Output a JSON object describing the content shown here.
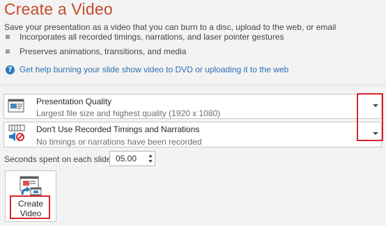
{
  "header": {
    "title": "Create a Video",
    "description": "Save your presentation as a video that you can burn to a disc, upload to the web, or email"
  },
  "bullets": [
    "Incorporates all recorded timings, narrations, and laser pointer gestures",
    "Preserves animations, transitions, and media"
  ],
  "help": {
    "icon": "help-icon",
    "icon_glyph": "?",
    "link_text": "Get help burning your slide show video to DVD or uploading it to the web"
  },
  "quality_dropdown": {
    "icon": "presentation-quality-icon",
    "label": "Presentation Quality",
    "description": "Largest file size and highest quality (1920 x 1080)"
  },
  "timings_dropdown": {
    "icon": "no-timings-icon",
    "label": "Don't Use Recorded Timings and Narrations",
    "description": "No timings or narrations have been recorded"
  },
  "seconds": {
    "label": "Seconds spent on each slide:",
    "value": "05.00"
  },
  "create_button": {
    "icon": "create-video-icon",
    "label_line1": "Create",
    "label_line2": "Video"
  },
  "colors": {
    "title": "#c34a2c",
    "link": "#2b6fb5",
    "highlight": "#d6262b"
  }
}
